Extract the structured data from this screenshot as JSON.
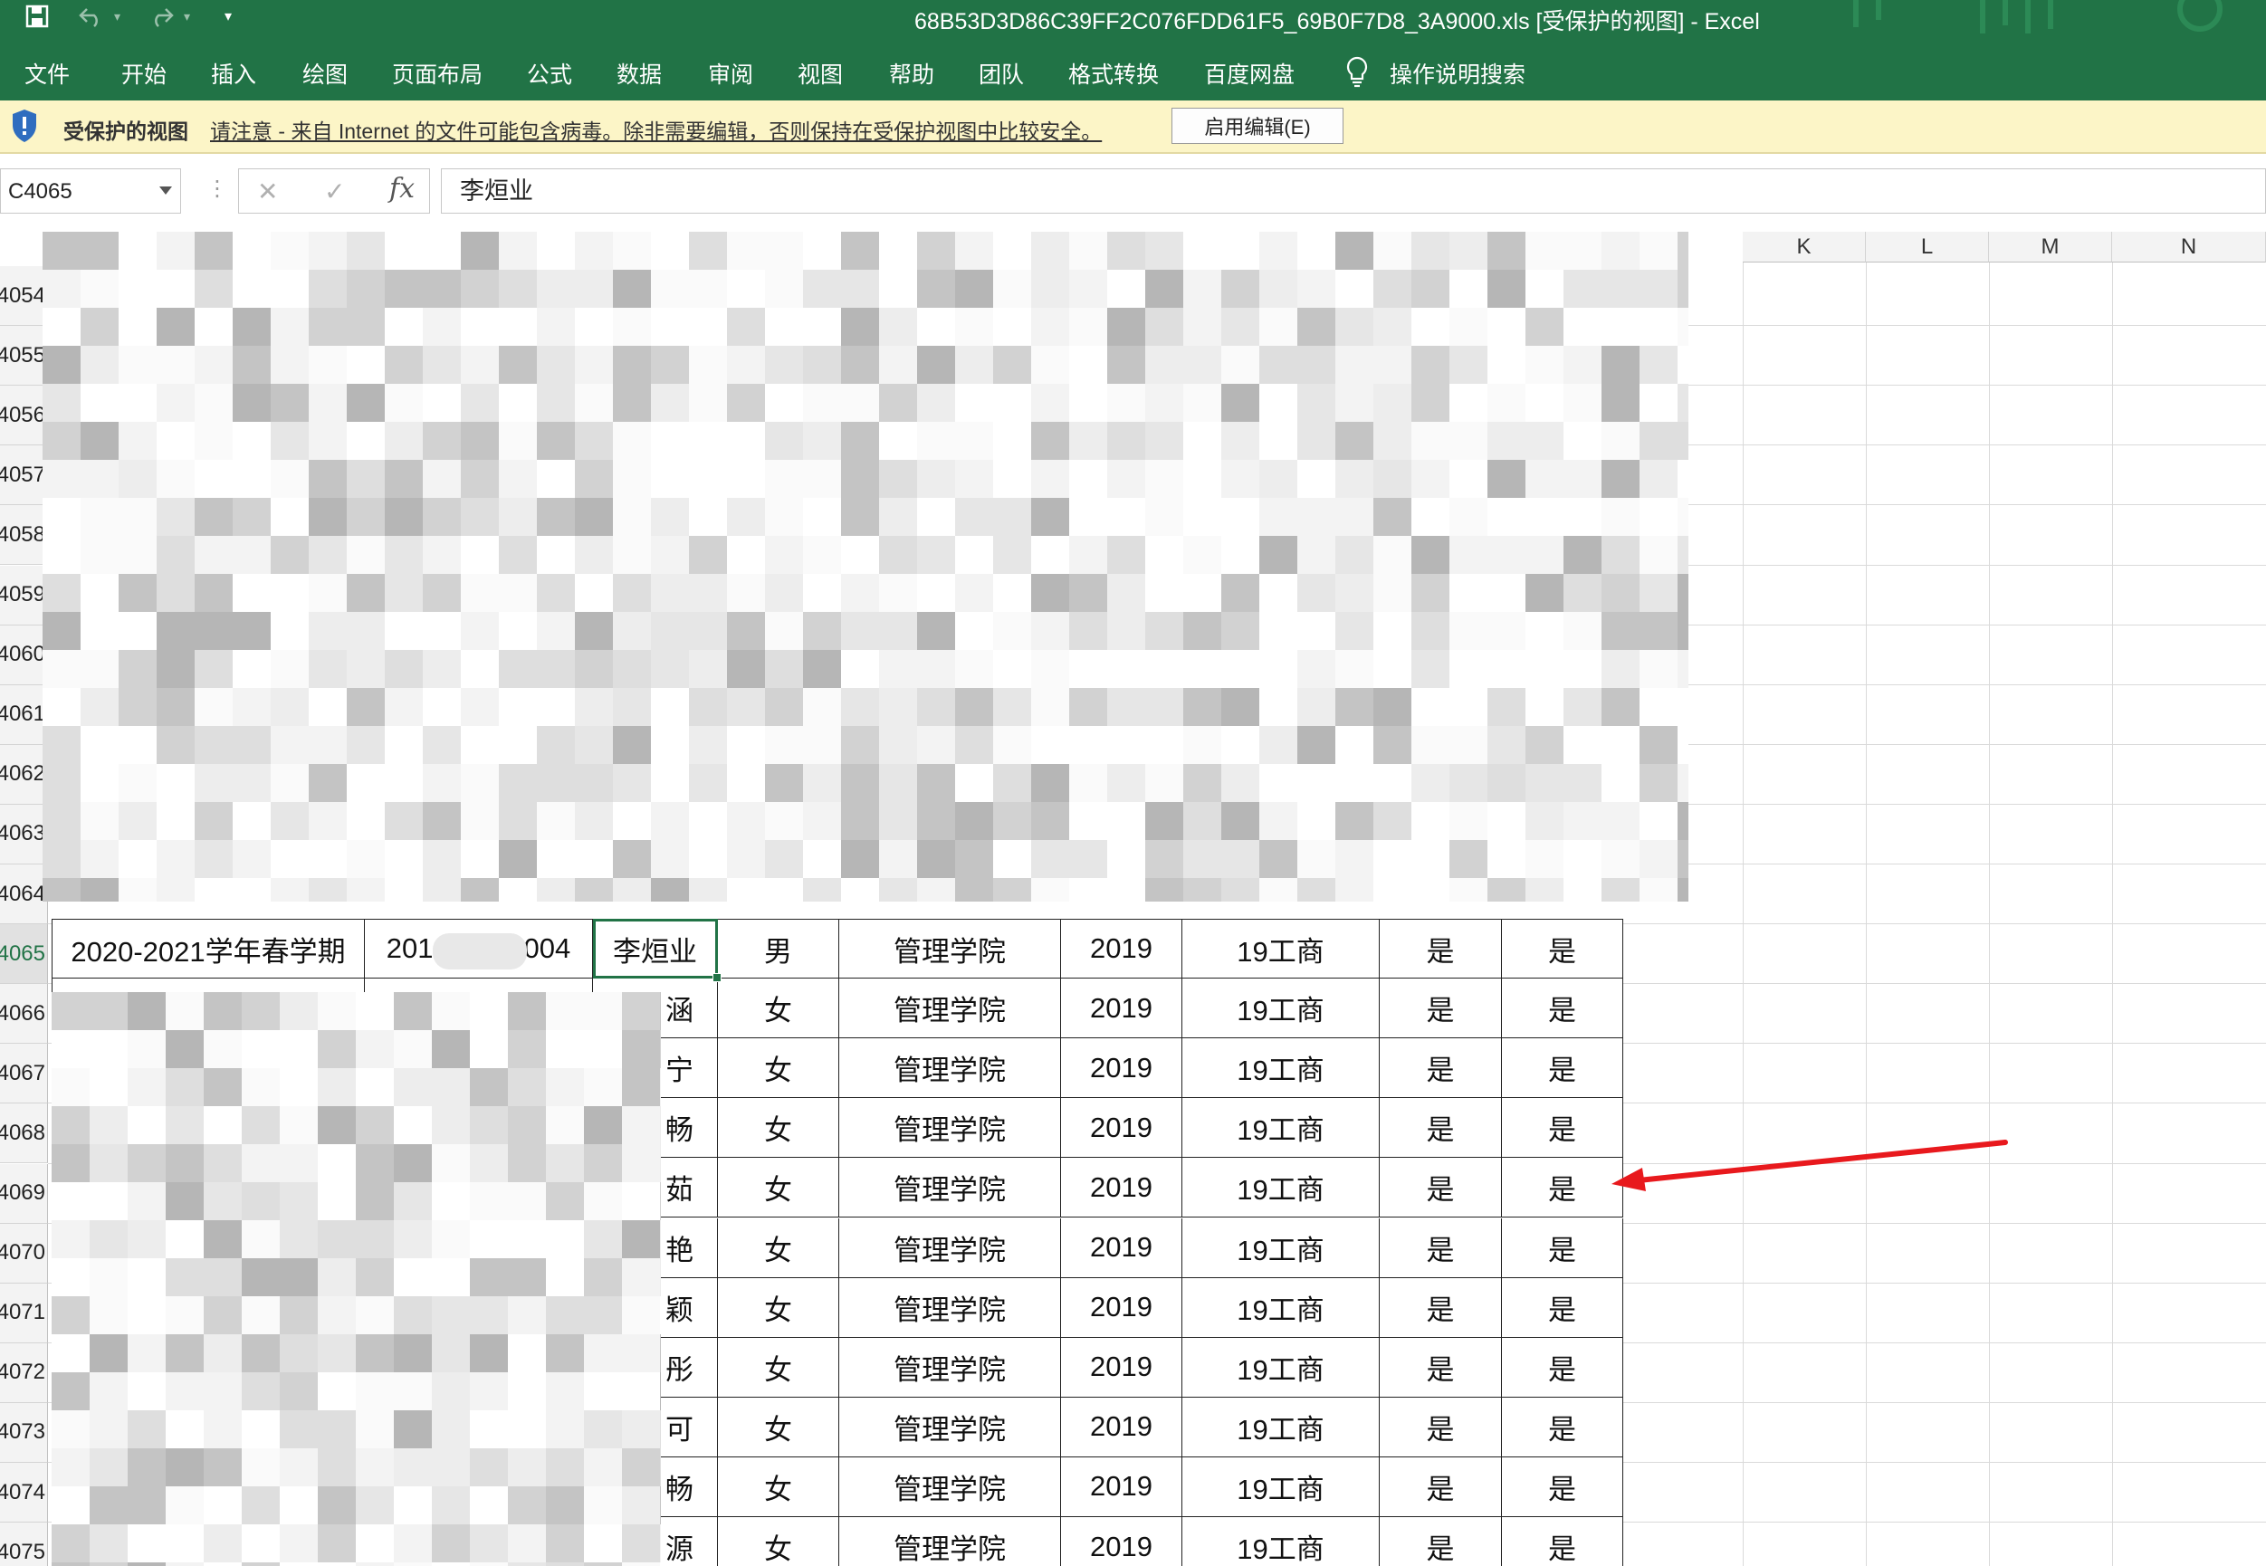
{
  "window": {
    "title": "68B53D3D86C39FF2C076FDD61F5_69B0F7D8_3A9000.xls [受保护的视图] - Excel"
  },
  "qat": {
    "save_icon": "save-icon",
    "undo_icon": "undo-icon",
    "redo_icon": "redo-icon",
    "customize_icon": "customize-qat-icon"
  },
  "ribbon": {
    "tabs": [
      "文件",
      "开始",
      "插入",
      "绘图",
      "页面布局",
      "公式",
      "数据",
      "审阅",
      "视图",
      "帮助",
      "团队",
      "格式转换",
      "百度网盘"
    ],
    "search_label": "操作说明搜索"
  },
  "protected_view": {
    "title": "受保护的视图",
    "message": "请注意 - 来自 Internet 的文件可能包含病毒。除非需要编辑，否则保持在受保护视图中比较安全。",
    "enable_button": "启用编辑(E)"
  },
  "formula_bar": {
    "name_box": "C4065",
    "cancel_icon": "✕",
    "enter_icon": "✓",
    "fx_label": "fx",
    "content": "李烜业"
  },
  "sheet": {
    "visible_columns": [
      "K",
      "L",
      "M",
      "N"
    ],
    "row_numbers": [
      "4054",
      "4055",
      "4056",
      "4057",
      "4058",
      "4059",
      "4060",
      "4061",
      "4062",
      "4063",
      "4064",
      "4065",
      "4066",
      "4067",
      "4068",
      "4069",
      "4070",
      "4071",
      "4072",
      "4073",
      "4074",
      "4075"
    ],
    "active_row": "4065",
    "highlight_row": {
      "term": "2020-2021学年春学期",
      "id_prefix": "201",
      "id_suffix": "004",
      "name": "李烜业",
      "gender": "男",
      "college": "管理学院",
      "year": "2019",
      "class": "19工商",
      "flag1": "是",
      "flag2": "是"
    },
    "rows": [
      {
        "row": "4066",
        "name_frag": "涵",
        "gender": "女",
        "college": "管理学院",
        "year": "2019",
        "class": "19工商",
        "flag1": "是",
        "flag2": "是"
      },
      {
        "row": "4067",
        "name_frag": "宁",
        "gender": "女",
        "college": "管理学院",
        "year": "2019",
        "class": "19工商",
        "flag1": "是",
        "flag2": "是"
      },
      {
        "row": "4068",
        "name_frag": "畅",
        "gender": "女",
        "college": "管理学院",
        "year": "2019",
        "class": "19工商",
        "flag1": "是",
        "flag2": "是"
      },
      {
        "row": "4069",
        "name_frag": "茹",
        "gender": "女",
        "college": "管理学院",
        "year": "2019",
        "class": "19工商",
        "flag1": "是",
        "flag2": "是"
      },
      {
        "row": "4070",
        "name_frag": "艳",
        "gender": "女",
        "college": "管理学院",
        "year": "2019",
        "class": "19工商",
        "flag1": "是",
        "flag2": "是"
      },
      {
        "row": "4071",
        "name_frag": "颖",
        "gender": "女",
        "college": "管理学院",
        "year": "2019",
        "class": "19工商",
        "flag1": "是",
        "flag2": "是"
      },
      {
        "row": "4072",
        "name_frag": "彤",
        "gender": "女",
        "college": "管理学院",
        "year": "2019",
        "class": "19工商",
        "flag1": "是",
        "flag2": "是"
      },
      {
        "row": "4073",
        "name_frag": "可",
        "gender": "女",
        "college": "管理学院",
        "year": "2019",
        "class": "19工商",
        "flag1": "是",
        "flag2": "是"
      },
      {
        "row": "4074",
        "name_frag": "畅",
        "gender": "女",
        "college": "管理学院",
        "year": "2019",
        "class": "19工商",
        "flag1": "是",
        "flag2": "是"
      },
      {
        "row": "4075",
        "name_frag": "源",
        "gender": "女",
        "college": "管理学院",
        "year": "2019",
        "class": "19工商",
        "flag1": "是",
        "flag2": "是"
      }
    ]
  },
  "colors": {
    "excel_green": "#217346",
    "protected_bar": "#fcf5c7",
    "annotation_arrow": "#e8191d"
  }
}
